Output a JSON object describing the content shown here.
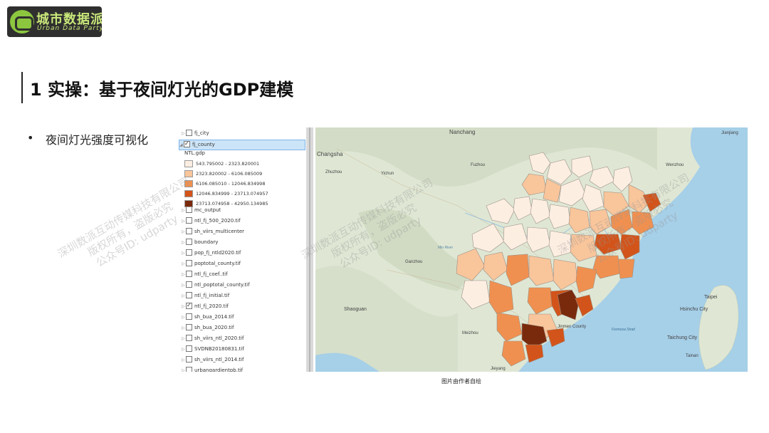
{
  "logo": {
    "name": "城市数据派",
    "sub": "Urban Data Party"
  },
  "title": "1 实操：基于夜间灯光的GDP建模",
  "bullet": "夜间灯光强度可视化",
  "caption": "图片由作者自绘",
  "toc": {
    "layers": [
      {
        "label": "fj_city",
        "checked": false
      },
      {
        "label": "fj_county",
        "checked": true,
        "selected": true
      },
      {
        "label": "mc_output",
        "checked": false
      },
      {
        "label": "ntl_fj_500_2020.tif",
        "checked": false
      },
      {
        "label": "sh_viirs_multicenter",
        "checked": false
      },
      {
        "label": "boundary",
        "checked": false
      },
      {
        "label": "pop_fj_ntld2020.tif",
        "checked": false
      },
      {
        "label": "poptotal_county.tif",
        "checked": false
      },
      {
        "label": "ntl_fj_coef..tif",
        "checked": false
      },
      {
        "label": "ntl_poptotal_county.tif",
        "checked": false
      },
      {
        "label": "ntl_fj_initial.tif",
        "checked": false
      },
      {
        "label": "ntl_fj_2020.tif",
        "checked": true
      },
      {
        "label": "sh_bua_2014.tif",
        "checked": false
      },
      {
        "label": "sh_bua_2020.tif",
        "checked": false
      },
      {
        "label": "sh_viirs_ntl_2020.tif",
        "checked": false
      },
      {
        "label": "SVDNB20180831.tif",
        "checked": false
      },
      {
        "label": "sh_viirs_ntl_2014.tif",
        "checked": false
      },
      {
        "label": "urbangardientpb.tif",
        "checked": false
      }
    ],
    "legend_title": "NTL.gdp",
    "legend": [
      {
        "label": "543.795002 - 2323.820001",
        "color": "#fdeee2"
      },
      {
        "label": "2323.820002 - 6106.085009",
        "color": "#f9c59b"
      },
      {
        "label": "6106.085010 - 12046.834998",
        "color": "#f09050"
      },
      {
        "label": "12046.834999 - 23713.074957",
        "color": "#d2541a"
      },
      {
        "label": "23713.074958 - 42950.134985",
        "color": "#7a2a0c"
      }
    ]
  },
  "map": {
    "labels": [
      "Nanchang",
      "Jianjiang",
      "Changsha",
      "Zhuzhou",
      "Yichun",
      "Fuzhou",
      "Wenzhou",
      "Ganzhou",
      "Min River",
      "Taipei",
      "Shaoguan",
      "Hsinchu City",
      "Jinmen County",
      "Formosa Strait",
      "Taichung City",
      "Meizhou",
      "Tainan",
      "Jieyang"
    ],
    "water_color": "#a6cfe8",
    "land_color": "#dfe7d4"
  },
  "watermark": {
    "line1": "深圳数派互动传媒科技有限公司",
    "line2": "版权所有，盗版必究",
    "line3": "公众号ID: udparty"
  }
}
